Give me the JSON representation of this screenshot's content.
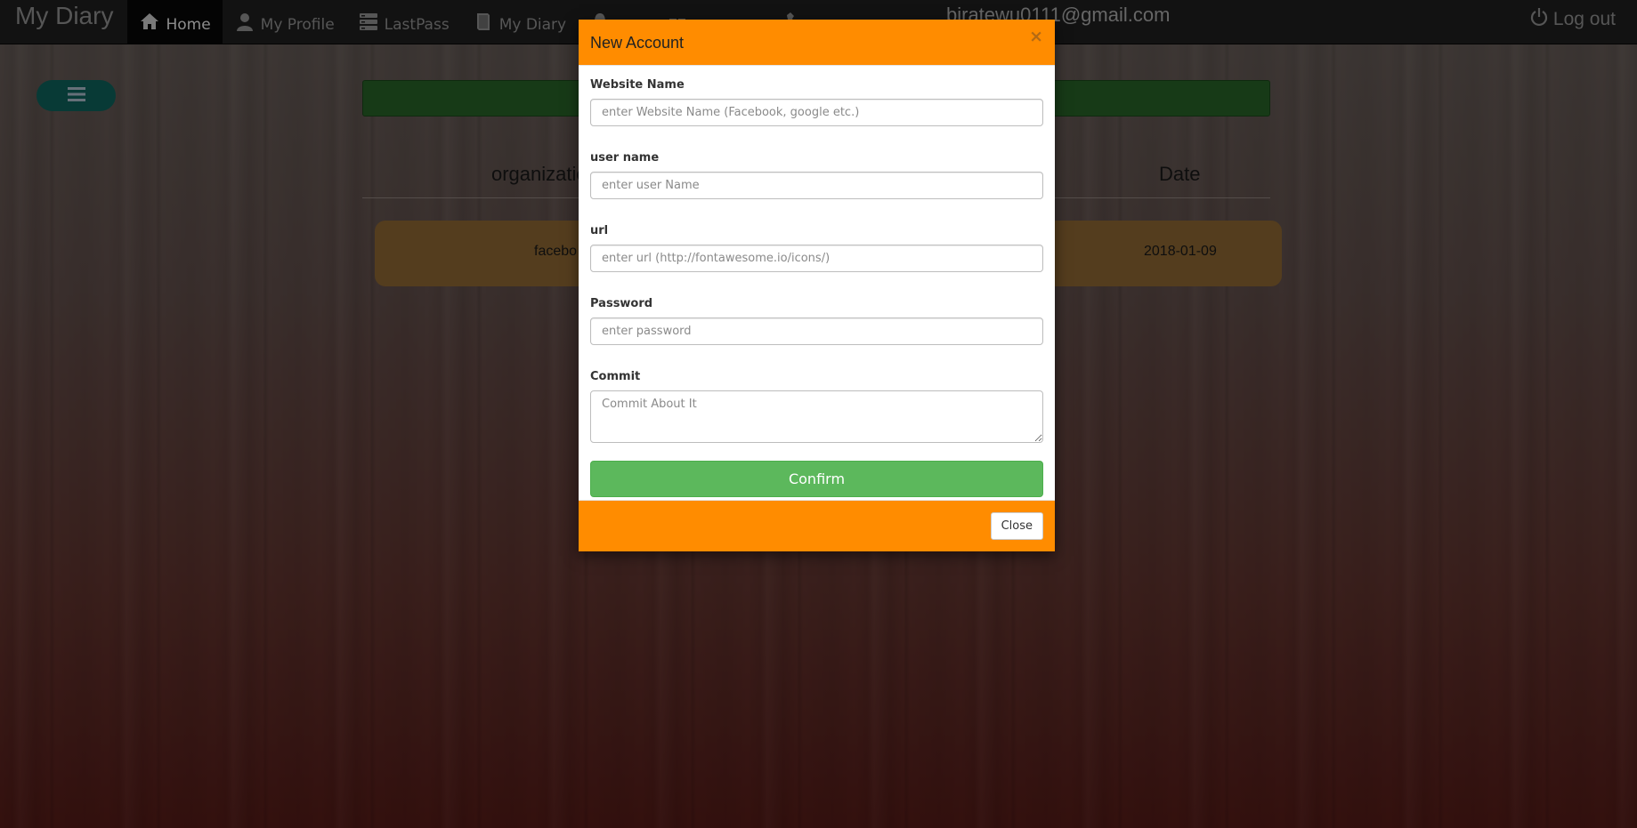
{
  "navbar": {
    "brand": "My Diary",
    "items": [
      {
        "label": "Home",
        "icon": "home-icon",
        "active": true
      },
      {
        "label": "My Profile",
        "icon": "user-icon"
      },
      {
        "label": "LastPass",
        "icon": "server-icon"
      },
      {
        "label": "My Diary",
        "icon": "book-icon"
      }
    ],
    "email": "biratewu0111@gmail.com",
    "logout_label": "Log out"
  },
  "page": {
    "table_headers": [
      "organizatio",
      "Date"
    ],
    "row": {
      "organization": "facebo",
      "date": "2018-01-09"
    }
  },
  "modal": {
    "title": "New Account",
    "close_x": "×",
    "fields": {
      "website": {
        "label": "Website Name",
        "placeholder": "enter Website Name (Facebook, google etc.)",
        "value": ""
      },
      "username": {
        "label": "user name",
        "placeholder": "enter user Name",
        "value": ""
      },
      "url": {
        "label": "url",
        "placeholder": "enter url (http://fontawesome.io/icons/)",
        "value": ""
      },
      "password": {
        "label": "Password",
        "placeholder": "enter password",
        "value": ""
      },
      "commit": {
        "label": "Commit",
        "placeholder": "Commit About It",
        "value": ""
      }
    },
    "confirm_label": "Confirm",
    "close_label": "Close"
  },
  "colors": {
    "modal_header": "#ff8c00",
    "confirm": "#5cb85c",
    "navbar": "#222222"
  }
}
